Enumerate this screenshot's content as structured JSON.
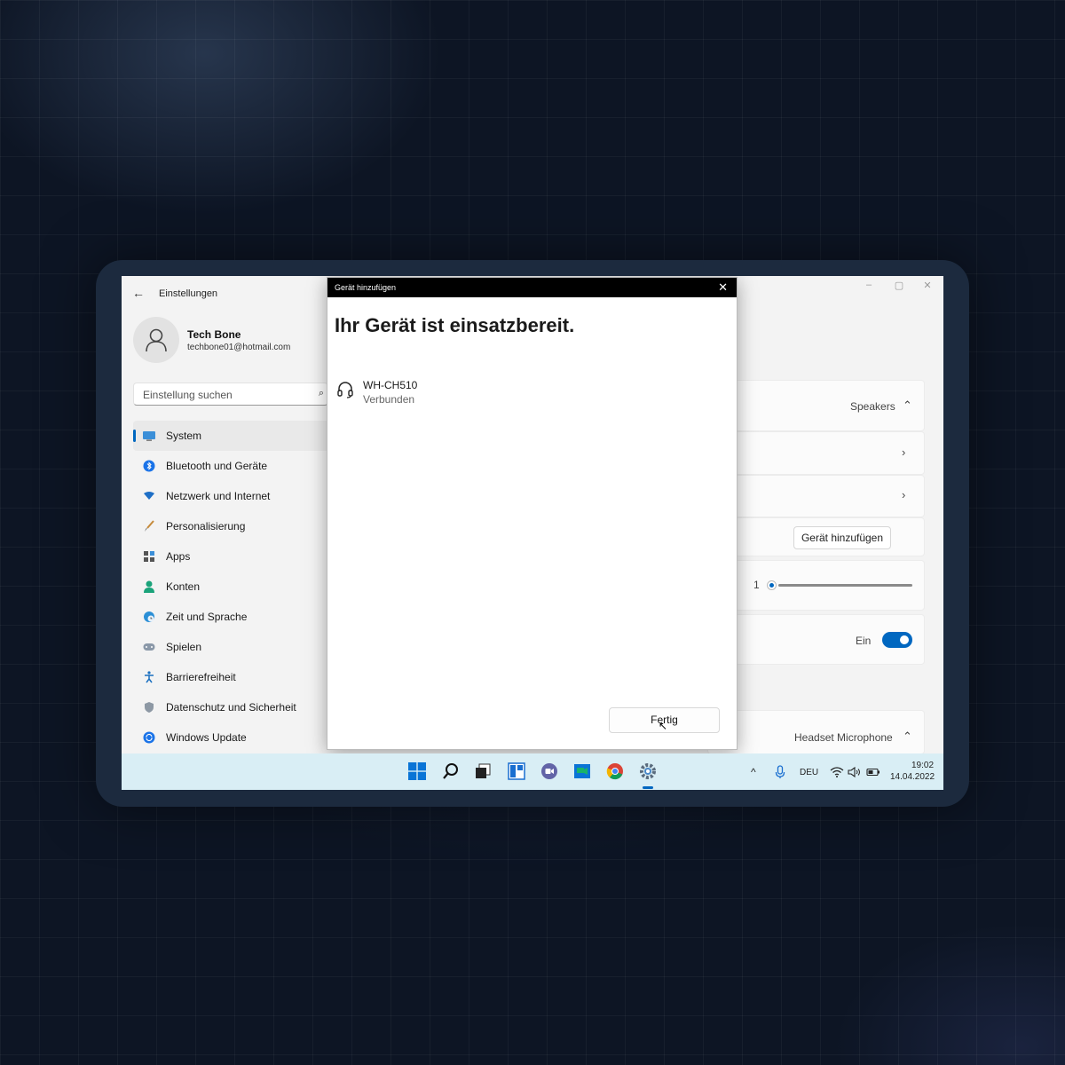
{
  "window": {
    "title": "Einstellungen",
    "min": "–",
    "max": "▢",
    "close": "✕"
  },
  "profile": {
    "name": "Tech Bone",
    "email": "techbone01@hotmail.com"
  },
  "search": {
    "placeholder": "Einstellung suchen"
  },
  "nav": {
    "items": [
      {
        "label": "System",
        "icon": "monitor-icon"
      },
      {
        "label": "Bluetooth und Geräte",
        "icon": "bluetooth-icon"
      },
      {
        "label": "Netzwerk und Internet",
        "icon": "wifi-icon"
      },
      {
        "label": "Personalisierung",
        "icon": "brush-icon"
      },
      {
        "label": "Apps",
        "icon": "apps-icon"
      },
      {
        "label": "Konten",
        "icon": "person-icon"
      },
      {
        "label": "Zeit und Sprache",
        "icon": "globe-clock-icon"
      },
      {
        "label": "Spielen",
        "icon": "gamepad-icon"
      },
      {
        "label": "Barrierefreiheit",
        "icon": "accessibility-icon"
      },
      {
        "label": "Datenschutz und Sicherheit",
        "icon": "shield-icon"
      },
      {
        "label": "Windows Update",
        "icon": "update-icon"
      }
    ]
  },
  "right": {
    "output_device": "Speakers",
    "add_device_button": "Gerät hinzufügen",
    "volume_value": "1",
    "volume_level": 0.0,
    "toggle_label": "Ein",
    "toggle_on": true,
    "input_device": "Headset Microphone"
  },
  "dialog": {
    "title": "Gerät hinzufügen",
    "heading": "Ihr Gerät ist einsatzbereit.",
    "device_name": "WH-CH510",
    "device_status": "Verbunden",
    "done_button": "Fertig"
  },
  "taskbar": {
    "apps": [
      "windows-start-icon",
      "search-icon",
      "task-view-icon",
      "widgets-icon",
      "teams-chat-icon",
      "meet-icon",
      "chrome-icon",
      "settings-gear-icon"
    ],
    "language": "DEU",
    "time": "19:02",
    "date": "14.04.2022"
  },
  "colors": {
    "accent": "#0067c0",
    "taskbar": "#d9eef5",
    "page_bg": "#0d1524"
  }
}
